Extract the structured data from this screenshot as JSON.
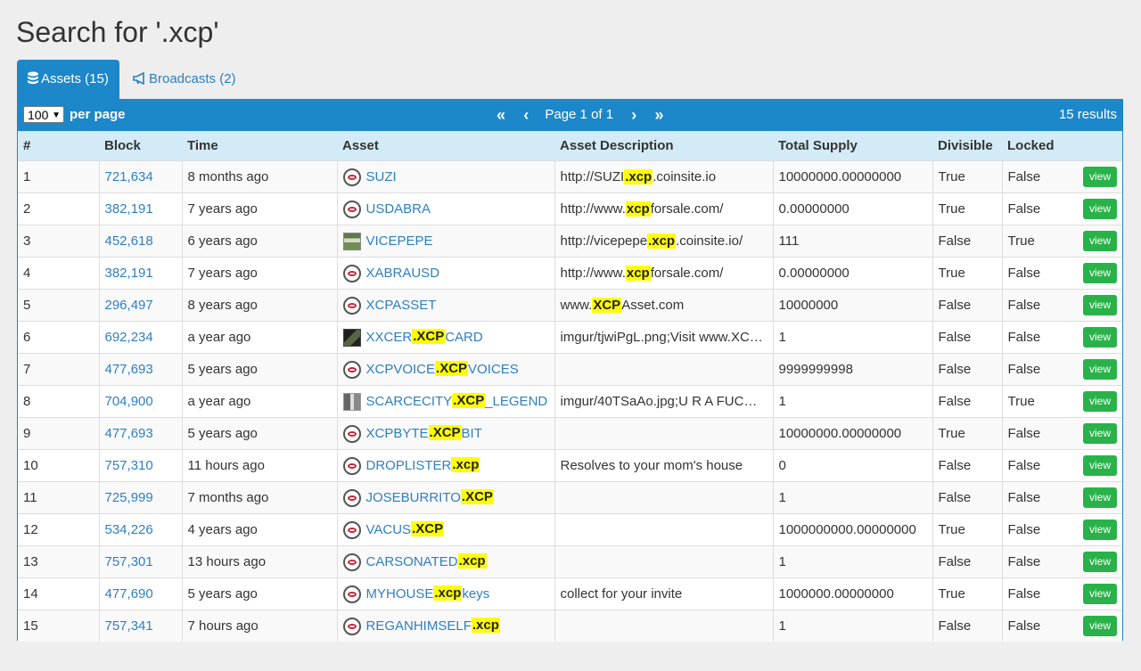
{
  "title": "Search for '.xcp'",
  "tabs": [
    {
      "label": "Assets (15)",
      "icon": "database-icon"
    },
    {
      "label": "Broadcasts (2)",
      "icon": "bullhorn-icon"
    }
  ],
  "pager": {
    "per_page_value": "100",
    "per_page_label": "per page",
    "first": "«",
    "prev": "‹",
    "page_text": "Page 1 of 1",
    "next": "›",
    "last": "»",
    "results": "15 results"
  },
  "columns": [
    "#",
    "Block",
    "Time",
    "Asset",
    "Asset Description",
    "Total Supply",
    "Divisible",
    "Locked"
  ],
  "view_label": "view",
  "colors": {
    "accent": "#1c87c9",
    "highlight": "#ffff00",
    "view_button": "#29b24a",
    "header_bg": "#d3ebf7"
  },
  "rows": [
    {
      "n": "1",
      "block": "721,634",
      "time": "8 months ago",
      "icon": "cp",
      "asset": [
        [
          "SUZI",
          0
        ]
      ],
      "desc": [
        [
          "http://SUZI",
          0
        ],
        [
          ".xcp",
          1
        ],
        [
          ".coinsite.io",
          0
        ]
      ],
      "supply": "10000000.00000000",
      "divisible": "True",
      "locked": "False"
    },
    {
      "n": "2",
      "block": "382,191",
      "time": "7 years ago",
      "icon": "cp",
      "asset": [
        [
          "USDABRA",
          0
        ]
      ],
      "desc": [
        [
          "http://www.",
          0
        ],
        [
          "xcp",
          1
        ],
        [
          "forsale.com/",
          0
        ]
      ],
      "supply": "0.00000000",
      "divisible": "True",
      "locked": "False"
    },
    {
      "n": "3",
      "block": "452,618",
      "time": "6 years ago",
      "icon": "img1",
      "asset": [
        [
          "VICEPEPE",
          0
        ]
      ],
      "desc": [
        [
          "http://vicepepe",
          0
        ],
        [
          ".xcp",
          1
        ],
        [
          ".coinsite.io/",
          0
        ]
      ],
      "supply": "111",
      "divisible": "False",
      "locked": "True"
    },
    {
      "n": "4",
      "block": "382,191",
      "time": "7 years ago",
      "icon": "cp",
      "asset": [
        [
          "XABRAUSD",
          0
        ]
      ],
      "desc": [
        [
          "http://www.",
          0
        ],
        [
          "xcp",
          1
        ],
        [
          "forsale.com/",
          0
        ]
      ],
      "supply": "0.00000000",
      "divisible": "True",
      "locked": "False"
    },
    {
      "n": "5",
      "block": "296,497",
      "time": "8 years ago",
      "icon": "cp",
      "asset": [
        [
          "XCPASSET",
          0
        ]
      ],
      "desc": [
        [
          "www.",
          0
        ],
        [
          "XCP",
          1
        ],
        [
          "Asset.com",
          0
        ]
      ],
      "supply": "10000000",
      "divisible": "False",
      "locked": "False"
    },
    {
      "n": "6",
      "block": "692,234",
      "time": "a year ago",
      "icon": "img2",
      "asset": [
        [
          "XXCER",
          0
        ],
        [
          ".XCP",
          1
        ],
        [
          "CARD",
          0
        ]
      ],
      "desc": [
        [
          "imgur/tjwiPgL.png;Visit www.XC…",
          0
        ]
      ],
      "supply": "1",
      "divisible": "False",
      "locked": "False"
    },
    {
      "n": "7",
      "block": "477,693",
      "time": "5 years ago",
      "icon": "cp",
      "asset": [
        [
          "XCPVOICE",
          0
        ],
        [
          ".XCP",
          1
        ],
        [
          "VOICES",
          0
        ]
      ],
      "desc": [],
      "supply": "9999999998",
      "divisible": "False",
      "locked": "False"
    },
    {
      "n": "8",
      "block": "704,900",
      "time": "a year ago",
      "icon": "img3",
      "asset": [
        [
          "SCARCECITY",
          0
        ],
        [
          ".XCP",
          1
        ],
        [
          "_LEGEND",
          0
        ]
      ],
      "desc": [
        [
          "imgur/40TSaAo.jpg;U R A FUC…",
          0
        ]
      ],
      "supply": "1",
      "divisible": "False",
      "locked": "True"
    },
    {
      "n": "9",
      "block": "477,693",
      "time": "5 years ago",
      "icon": "cp",
      "asset": [
        [
          "XCPBYTE",
          0
        ],
        [
          ".XCP",
          1
        ],
        [
          "BIT",
          0
        ]
      ],
      "desc": [],
      "supply": "10000000.00000000",
      "divisible": "True",
      "locked": "False"
    },
    {
      "n": "10",
      "block": "757,310",
      "time": "11 hours ago",
      "icon": "cp",
      "asset": [
        [
          "DROPLISTER",
          0
        ],
        [
          ".xcp",
          1
        ]
      ],
      "desc": [
        [
          "Resolves to your mom's house",
          0
        ]
      ],
      "supply": "0",
      "divisible": "False",
      "locked": "False"
    },
    {
      "n": "11",
      "block": "725,999",
      "time": "7 months ago",
      "icon": "cp",
      "asset": [
        [
          "JOSEBURRITO",
          0
        ],
        [
          ".XCP",
          1
        ]
      ],
      "desc": [],
      "supply": "1",
      "divisible": "False",
      "locked": "False"
    },
    {
      "n": "12",
      "block": "534,226",
      "time": "4 years ago",
      "icon": "cp",
      "asset": [
        [
          "VACUS",
          0
        ],
        [
          ".XCP",
          1
        ]
      ],
      "desc": [],
      "supply": "1000000000.00000000",
      "divisible": "True",
      "locked": "False"
    },
    {
      "n": "13",
      "block": "757,301",
      "time": "13 hours ago",
      "icon": "cp",
      "asset": [
        [
          "CARSONATED",
          0
        ],
        [
          ".xcp",
          1
        ]
      ],
      "desc": [],
      "supply": "1",
      "divisible": "False",
      "locked": "False"
    },
    {
      "n": "14",
      "block": "477,690",
      "time": "5 years ago",
      "icon": "cp",
      "asset": [
        [
          "MYHOUSE",
          0
        ],
        [
          ".xcp",
          1
        ],
        [
          "keys",
          0
        ]
      ],
      "desc": [
        [
          "collect for your invite",
          0
        ]
      ],
      "supply": "1000000.00000000",
      "divisible": "True",
      "locked": "False"
    },
    {
      "n": "15",
      "block": "757,341",
      "time": "7 hours ago",
      "icon": "cp",
      "asset": [
        [
          "REGANHIMSELF",
          0
        ],
        [
          ".xcp",
          1
        ]
      ],
      "desc": [],
      "supply": "1",
      "divisible": "False",
      "locked": "False"
    }
  ]
}
